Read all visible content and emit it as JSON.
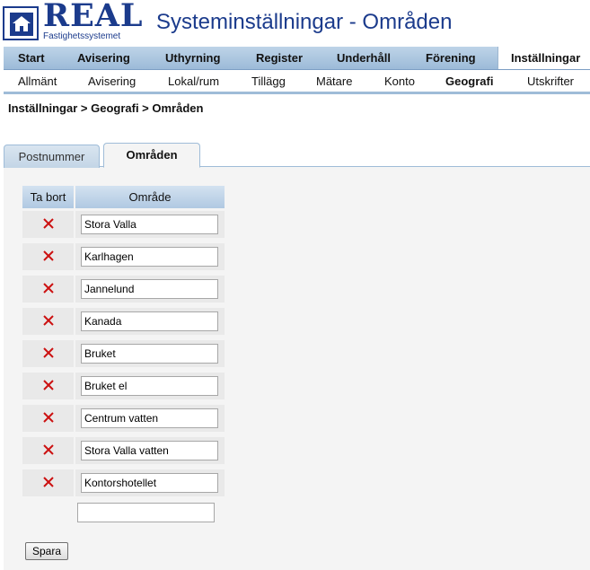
{
  "header": {
    "logo_text": "REAL",
    "logo_subtext": "Fastighetssystemet",
    "title": "Systeminställningar - Områden"
  },
  "nav_main": {
    "items": [
      {
        "label": "Start"
      },
      {
        "label": "Avisering"
      },
      {
        "label": "Uthyrning"
      },
      {
        "label": "Register"
      },
      {
        "label": "Underhåll"
      },
      {
        "label": "Förening"
      },
      {
        "label": "Inställningar"
      }
    ],
    "active": "Inställningar"
  },
  "nav_sub": {
    "items": [
      {
        "label": "Allmänt"
      },
      {
        "label": "Avisering"
      },
      {
        "label": "Lokal/rum"
      },
      {
        "label": "Tillägg"
      },
      {
        "label": "Mätare"
      },
      {
        "label": "Konto"
      },
      {
        "label": "Geografi"
      },
      {
        "label": "Utskrifter"
      }
    ],
    "active": "Geografi"
  },
  "breadcrumb": "Inställningar > Geografi > Områden",
  "tabs": [
    {
      "label": "Postnummer"
    },
    {
      "label": "Områden"
    }
  ],
  "table": {
    "col_delete": "Ta bort",
    "col_area": "Område",
    "rows": [
      {
        "area": "Stora Valla"
      },
      {
        "area": "Karlhagen"
      },
      {
        "area": "Jannelund"
      },
      {
        "area": "Kanada"
      },
      {
        "area": "Bruket"
      },
      {
        "area": "Bruket el"
      },
      {
        "area": "Centrum vatten"
      },
      {
        "area": "Stora Valla vatten"
      },
      {
        "area": "Kontorshotellet"
      }
    ],
    "new_area_value": ""
  },
  "save_label": "Spara",
  "colors": {
    "brand": "#1b3b8c",
    "delete_icon": "#cc1111",
    "nav_bg": "#b0c9e2"
  }
}
